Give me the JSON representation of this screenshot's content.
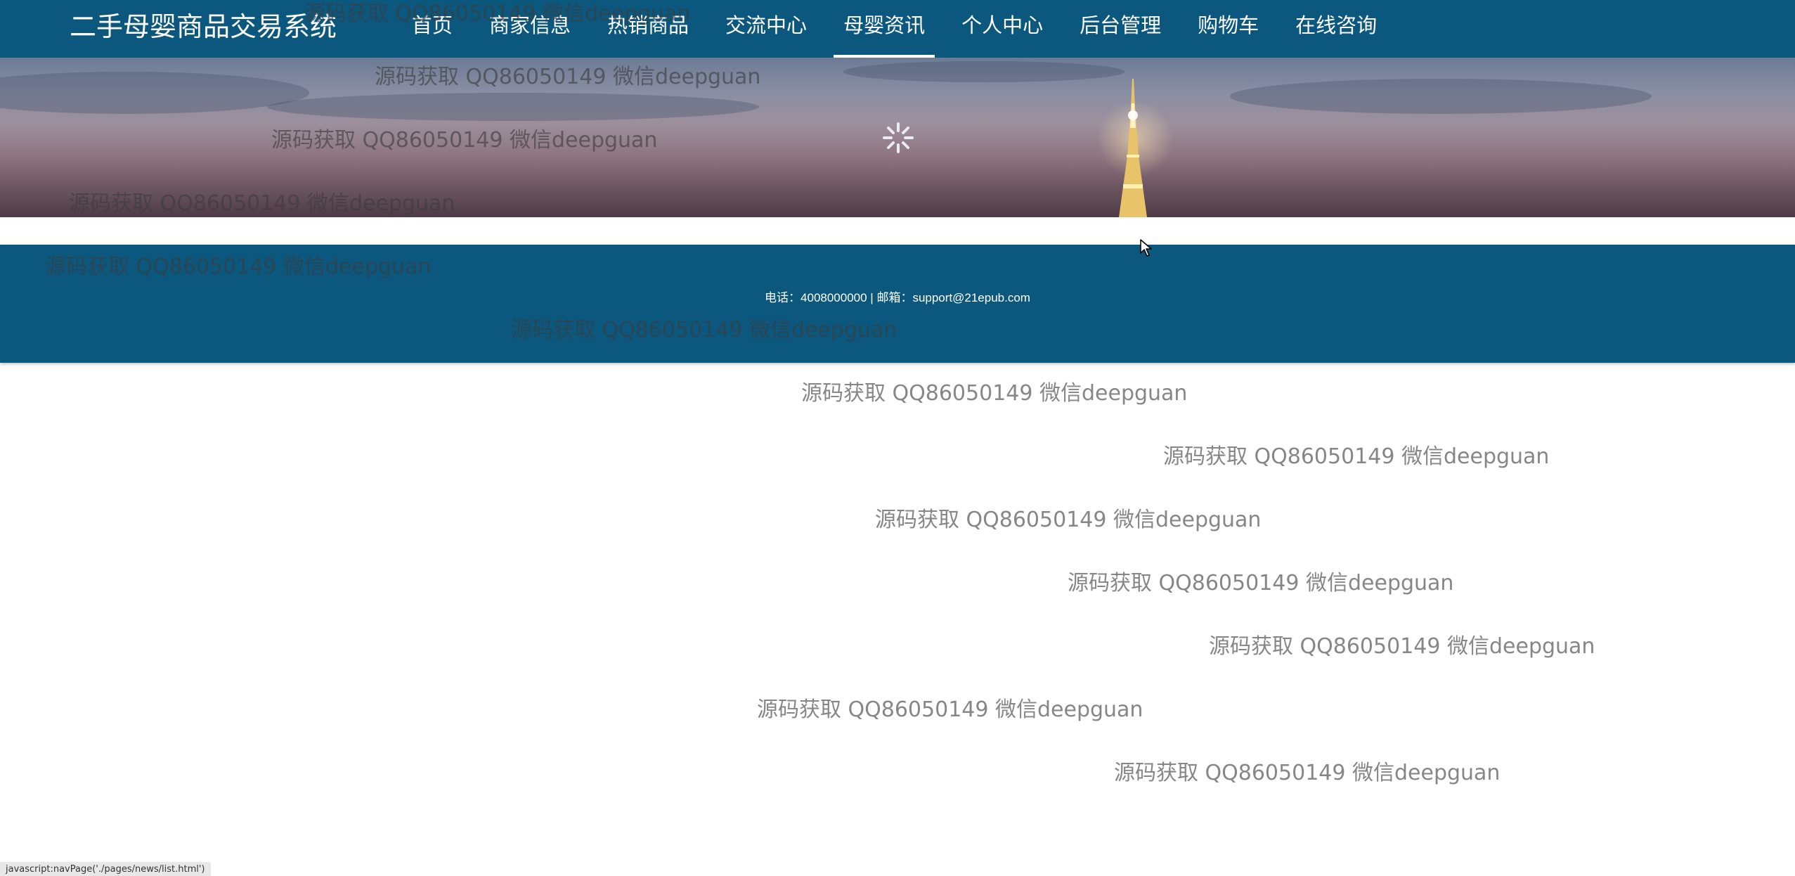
{
  "header": {
    "brand": "二手母婴商品交易系统",
    "nav": [
      {
        "label": "首页",
        "active": false
      },
      {
        "label": "商家信息",
        "active": false
      },
      {
        "label": "热销商品",
        "active": false
      },
      {
        "label": "交流中心",
        "active": false
      },
      {
        "label": "母婴资讯",
        "active": true
      },
      {
        "label": "个人中心",
        "active": false
      },
      {
        "label": "后台管理",
        "active": false
      },
      {
        "label": "购物车",
        "active": false
      },
      {
        "label": "在线咨询",
        "active": false
      }
    ]
  },
  "banner": {
    "icons": [
      "loading-spinner-icon",
      "eiffel-tower-image"
    ]
  },
  "footer": {
    "contact": "电话：4008000000 | 邮箱：support@21epub.com"
  },
  "watermarks": [
    "源码获取 QQ86050149 微信deepguan",
    "源码获取 QQ86050149 微信deepguan",
    "源码获取 QQ86050149 微信deepguan",
    "源码获取 QQ86050149 微信deepguan",
    "源码获取 QQ86050149 微信deepguan",
    "源码获取 QQ86050149 微信deepguan",
    "源码获取 QQ86050149 微信deepguan",
    "源码获取 QQ86050149 微信deepguan",
    "源码获取 QQ86050149 微信deepguan",
    "源码获取 QQ86050149 微信deepguan",
    "源码获取 QQ86050149 微信deepguan",
    "源码获取 QQ86050149 微信deepguan",
    "源码获取 QQ86050149 微信deepguan"
  ],
  "status_bar": {
    "text": "javascript:navPage('./pages/news/list.html')"
  },
  "colors": {
    "nav_background": "#0b577e",
    "footer_background": "#0b577e",
    "nav_text": "#ffffff"
  }
}
